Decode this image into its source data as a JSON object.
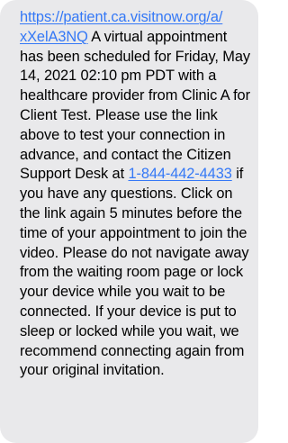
{
  "message": {
    "url_part1": "https://patient.ca.visitnow.org/a/",
    "url_part2": "xXelA3NQ",
    "text_a": " A virtual appointment has been scheduled for Friday, May 14, 2021 02:10 pm PDT with a healthcare provider from Clinic A for Client Test. Please use the link above to test your connection in advance, and contact the Citizen Support Desk at ",
    "phone": "1-844-442-4433",
    "text_b": " if you have any questions. Click on the link again 5 minutes before the time of your appointment to join the video. Please do not navigate away from the waiting room page or lock your device while you wait to be connected. If your device is put to sleep or locked while you wait, we recommend connecting again from your original invitation."
  },
  "colors": {
    "bubble": "#e9e9eb",
    "link": "#3478f6",
    "text": "#000000"
  }
}
